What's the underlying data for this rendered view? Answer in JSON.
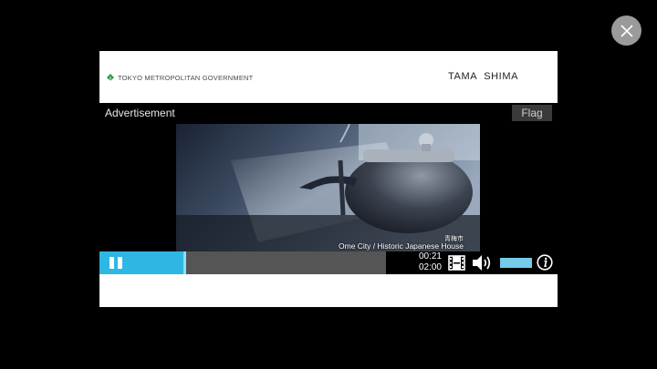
{
  "close": {
    "icon": "close-icon"
  },
  "banner": {
    "logo_icon": "ginkgo-leaf-icon",
    "org_name": "TOKYO METROPOLITAN GOVERNMENT",
    "title": "TAMA SHIMA",
    "logo_color": "#2e9b47"
  },
  "ad": {
    "label": "Advertisement",
    "flag_label": "Flag"
  },
  "video": {
    "caption_jp": "青梅市",
    "caption_en": "Ome City / Historic Japanese House"
  },
  "player": {
    "pause_icon": "pause-icon",
    "progress": 0.175,
    "current_time": "00:21",
    "duration": "02:00",
    "fullscreen_icon": "film-icon",
    "volume_icon": "speaker-icon",
    "volume_level": 1.0,
    "info_icon": "info-icon",
    "accent": "#2eb7e4"
  }
}
